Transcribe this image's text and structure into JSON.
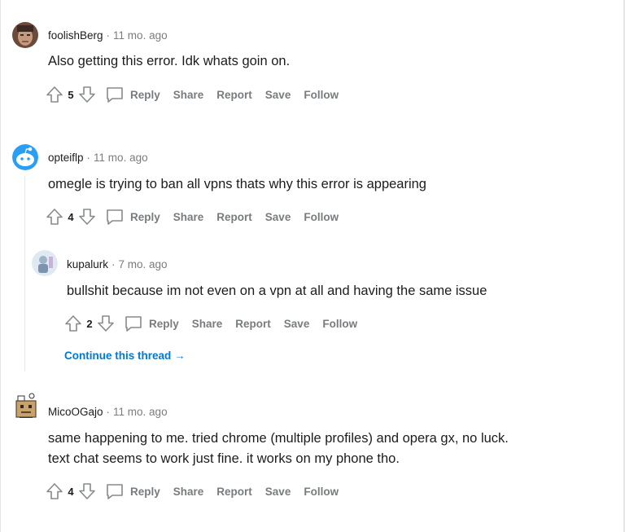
{
  "actions": {
    "reply": "Reply",
    "share": "Share",
    "report": "Report",
    "save": "Save",
    "follow": "Follow"
  },
  "comments": [
    {
      "author": "foolishBerg",
      "time": "11 mo. ago",
      "lines": [
        "Also getting this error. Idk whats goin on."
      ],
      "score": "5"
    },
    {
      "author": "opteiflp",
      "time": "11 mo. ago",
      "lines": [
        "omegle is trying to ban all vpns thats why this error is appearing"
      ],
      "score": "4"
    },
    {
      "author": "kupalurk",
      "time": "7 mo. ago",
      "lines": [
        "bullshit because im not even on a vpn at all and having the same issue"
      ],
      "score": "2"
    },
    {
      "author": "MicoOGajo",
      "time": "11 mo. ago",
      "lines": [
        "same happening to me. tried chrome (multiple profiles) and opera gx, no luck.",
        "text chat seems to work just fine. it works on my phone tho."
      ],
      "score": "4"
    }
  ],
  "continue_thread": "Continue this thread",
  "continue_arrow": "→",
  "meta_separator": "·",
  "colors": {
    "meta": "#7c7c7c",
    "action": "#787c7e",
    "link": "#0079d3",
    "thread_line": "#e8e8e8"
  }
}
